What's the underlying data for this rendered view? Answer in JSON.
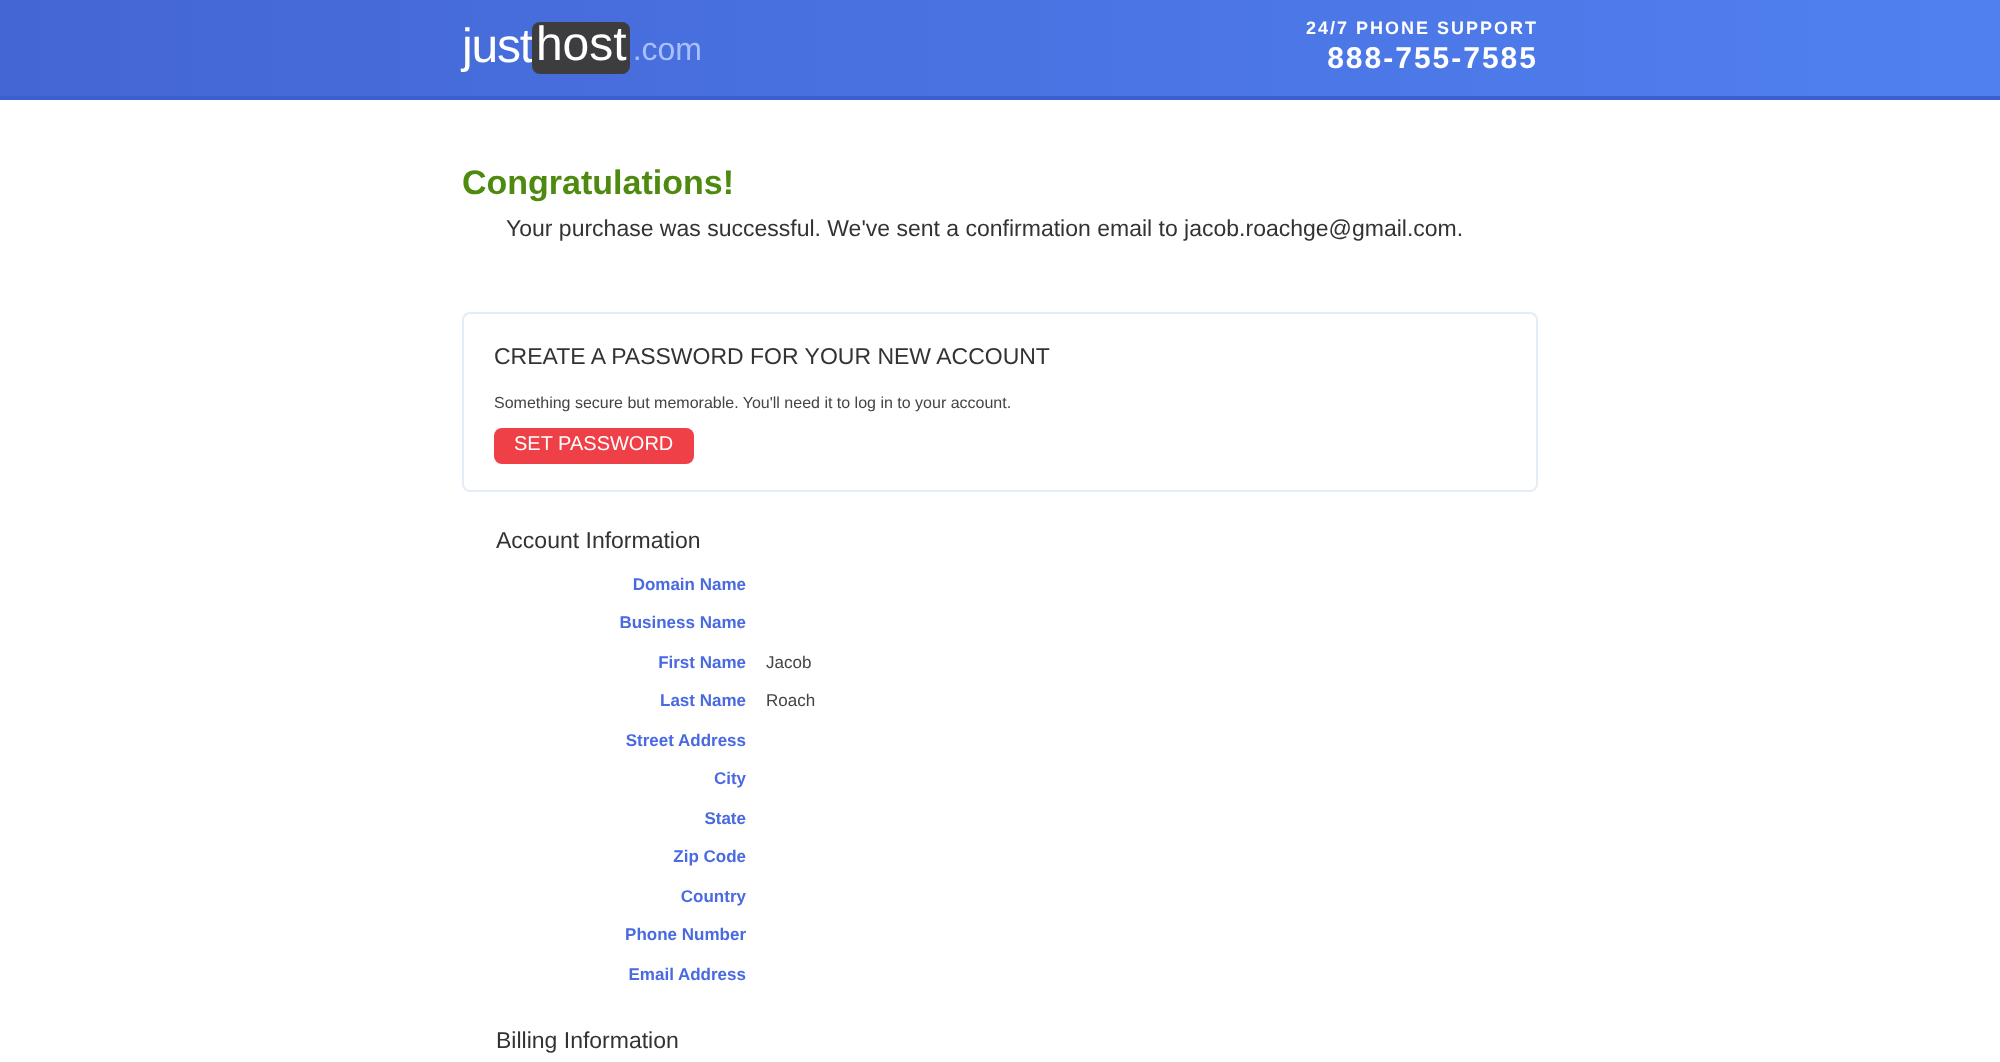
{
  "header": {
    "logo": {
      "parts": [
        "just",
        "host",
        ".com"
      ]
    },
    "support_label": "24/7 PHONE SUPPORT",
    "phone": "888-755-7585"
  },
  "confirmation": {
    "title": "Congratulations!",
    "message": "Your purchase was successful. We've sent a confirmation email to jacob.roachge@gmail.com."
  },
  "password_card": {
    "title": "CREATE A PASSWORD FOR YOUR NEW ACCOUNT",
    "description": "Something secure but memorable. You'll need it to log in to your account.",
    "button": "SET PASSWORD"
  },
  "account_information": {
    "title": "Account Information",
    "fields": [
      {
        "label": "Domain Name"
      },
      {
        "label": "Business Name"
      },
      {
        "label": "First Name",
        "value": "Jacob"
      },
      {
        "label": "Last Name",
        "value": "Roach"
      },
      {
        "label": "Street Address"
      },
      {
        "label": "City"
      },
      {
        "label": "State"
      },
      {
        "label": "Zip Code"
      },
      {
        "label": "Country"
      },
      {
        "label": "Phone Number"
      },
      {
        "label": "Email Address"
      }
    ]
  },
  "billing_information": {
    "title": "Billing Information"
  }
}
